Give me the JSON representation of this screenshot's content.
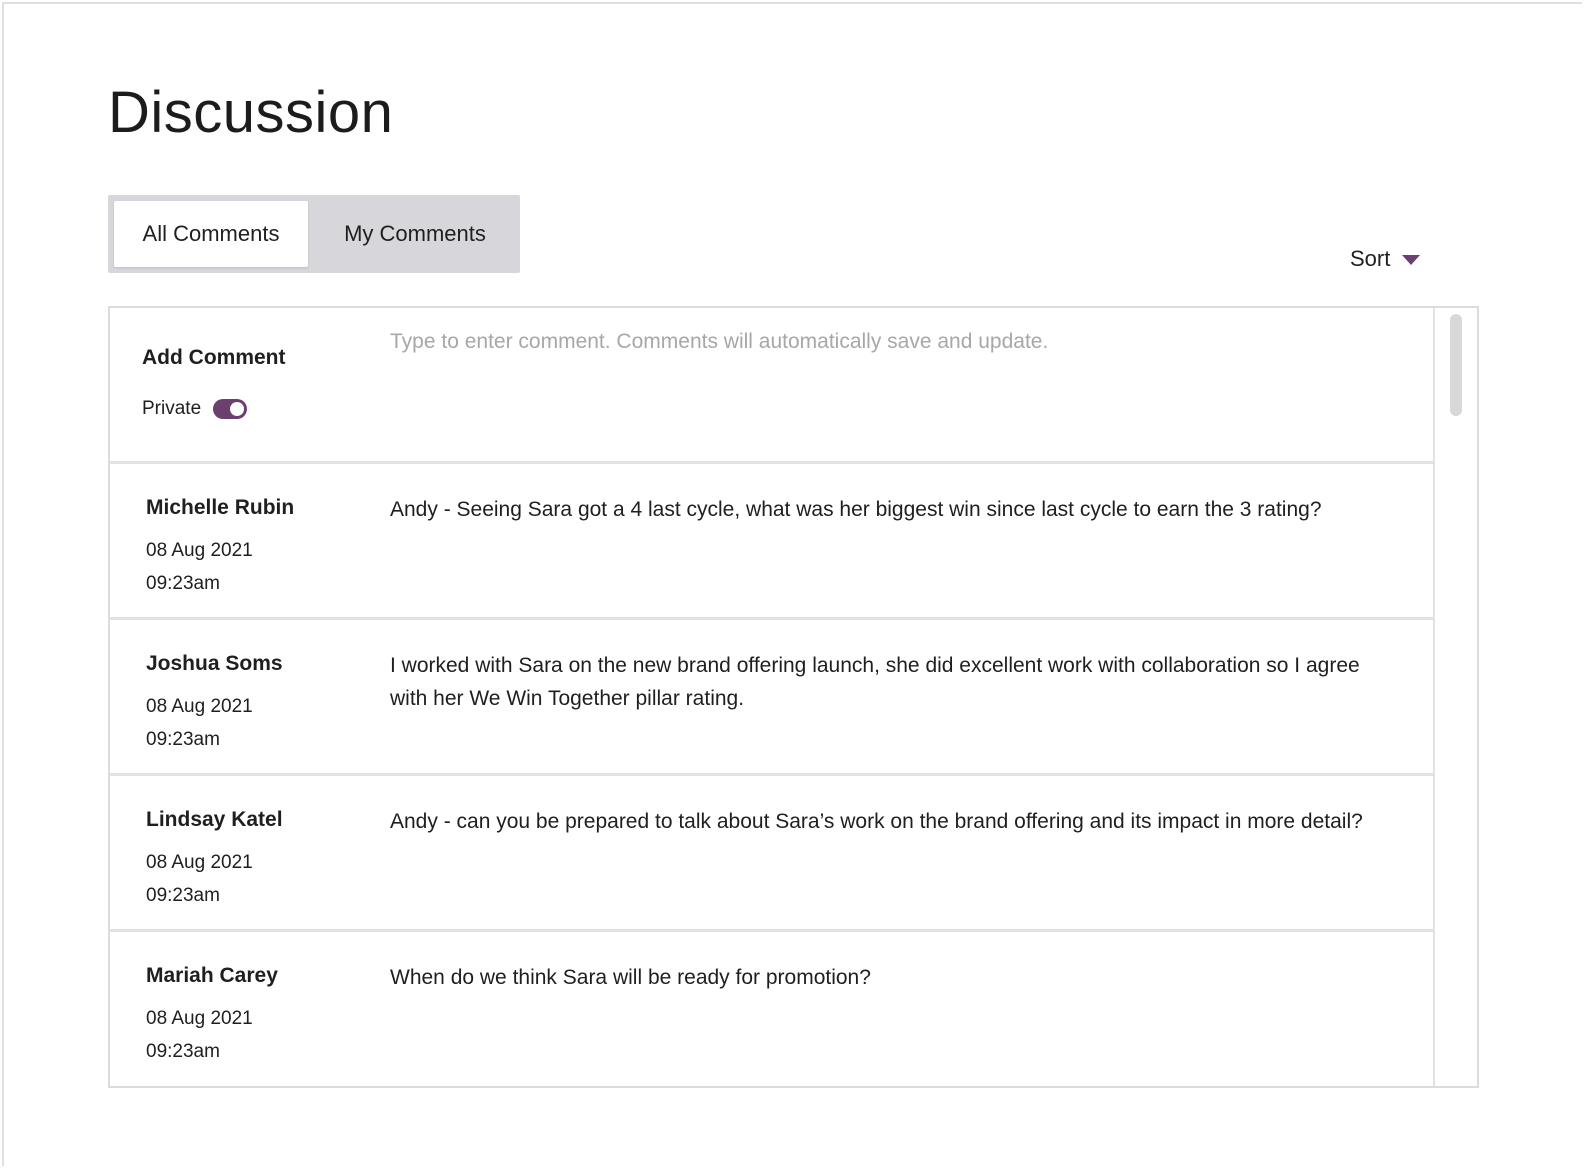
{
  "page": {
    "title": "Discussion"
  },
  "tabs": {
    "all": "All Comments",
    "mine": "My Comments"
  },
  "sort": {
    "label": "Sort"
  },
  "add_comment": {
    "label": "Add Comment",
    "placeholder": "Type to enter comment. Comments will automatically save and update.",
    "private_label": "Private",
    "private_on": true
  },
  "comments": [
    {
      "author": "Michelle Rubin",
      "date": "08 Aug 2021",
      "time": "09:23am",
      "text": "Andy - Seeing Sara got a 4 last cycle, what was her biggest win since last cycle to earn the 3 rating?"
    },
    {
      "author": "Joshua Soms",
      "date": "08 Aug 2021",
      "time": "09:23am",
      "text": "I worked with Sara on the new brand offering launch, she did excellent work with collaboration so I agree with her We Win Together pillar rating."
    },
    {
      "author": "Lindsay Katel",
      "date": "08 Aug 2021",
      "time": "09:23am",
      "text": "Andy - can you be prepared to talk about Sara’s work on the brand offering and its impact in more detail?"
    },
    {
      "author": "Mariah Carey",
      "date": "08 Aug 2021",
      "time": "09:23am",
      "text": "When do we think Sara will be ready for promotion?"
    }
  ],
  "colors": {
    "accent": "#6b3f6e",
    "tab_bg": "#d7d6da",
    "border": "#dcdcdc",
    "placeholder": "#a7a7a7"
  },
  "icons": {
    "sort": "caret-down-icon",
    "private_toggle": "toggle-switch"
  }
}
